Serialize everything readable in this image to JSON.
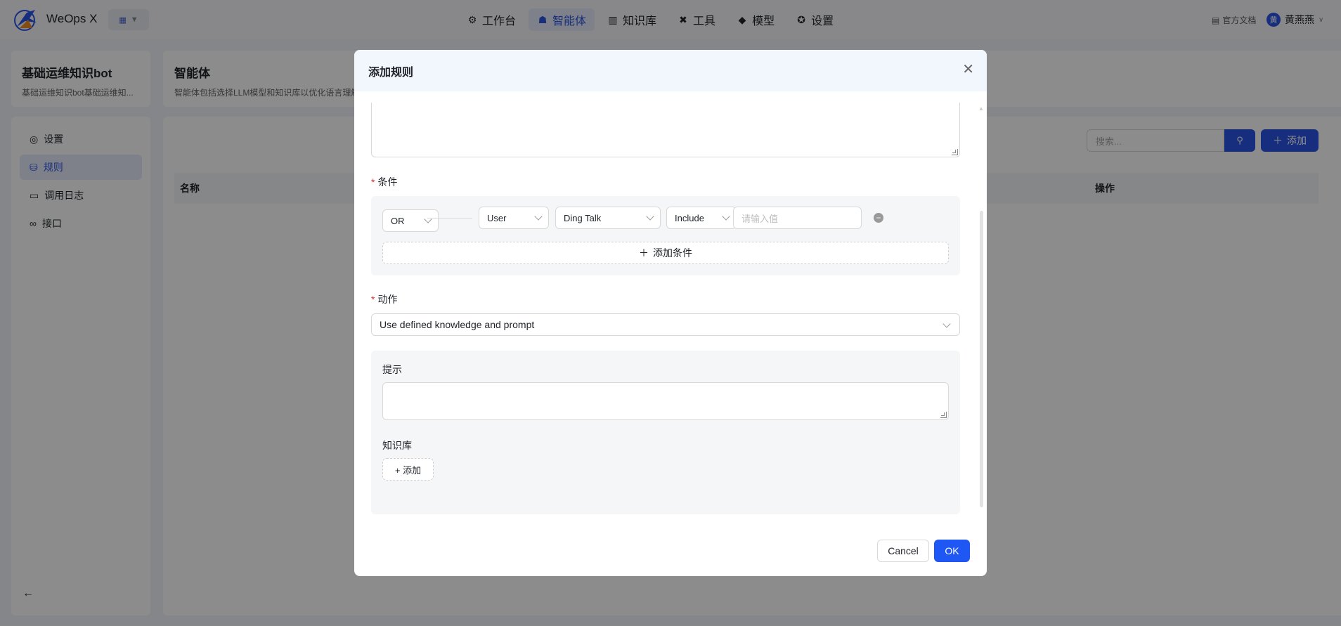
{
  "app": {
    "name": "WeOps X",
    "nav": [
      {
        "label": "工作台",
        "icon": "robot-icon"
      },
      {
        "label": "智能体",
        "icon": "agent-icon"
      },
      {
        "label": "知识库",
        "icon": "books-icon"
      },
      {
        "label": "工具",
        "icon": "tools-icon"
      },
      {
        "label": "模型",
        "icon": "cube-icon"
      },
      {
        "label": "设置",
        "icon": "gear-icon"
      }
    ],
    "active_nav": "智能体",
    "doc_link": "官方文档",
    "user": {
      "avatar_char": "黄",
      "name": "黄燕燕"
    }
  },
  "bot": {
    "title": "基础运维知识bot",
    "subtitle": "基础运维知识bot基础运维知..."
  },
  "agent": {
    "title": "智能体",
    "desc": "智能体包括选择LLM模型和知识库以优化语言理解"
  },
  "sidebar": {
    "items": [
      {
        "label": "设置",
        "icon": "settings-icon"
      },
      {
        "label": "规则",
        "icon": "rules-icon"
      },
      {
        "label": "调用日志",
        "icon": "chat-log-icon"
      },
      {
        "label": "接口",
        "icon": "link-icon"
      }
    ],
    "active": "规则"
  },
  "main": {
    "search_placeholder": "搜索...",
    "add_label": "添加",
    "columns": [
      "名称",
      "操作"
    ]
  },
  "modal": {
    "title": "添加规则",
    "condition_label": "条件",
    "condition": {
      "logic": "OR",
      "field": "User",
      "channel": "Ding Talk",
      "operator": "Include",
      "value_placeholder": "请输入值"
    },
    "add_condition_label": "添加条件",
    "action_label": "动作",
    "action_value": "Use defined knowledge and prompt",
    "prompt_label": "提示",
    "knowledge_label": "知识库",
    "knowledge_add_label": "+ 添加",
    "cancel_label": "Cancel",
    "ok_label": "OK"
  },
  "colors": {
    "primary": "#1f57f5",
    "required": "#e03131",
    "panel_bg": "#f5f6f8",
    "header_bg": "#f2f6fd"
  }
}
